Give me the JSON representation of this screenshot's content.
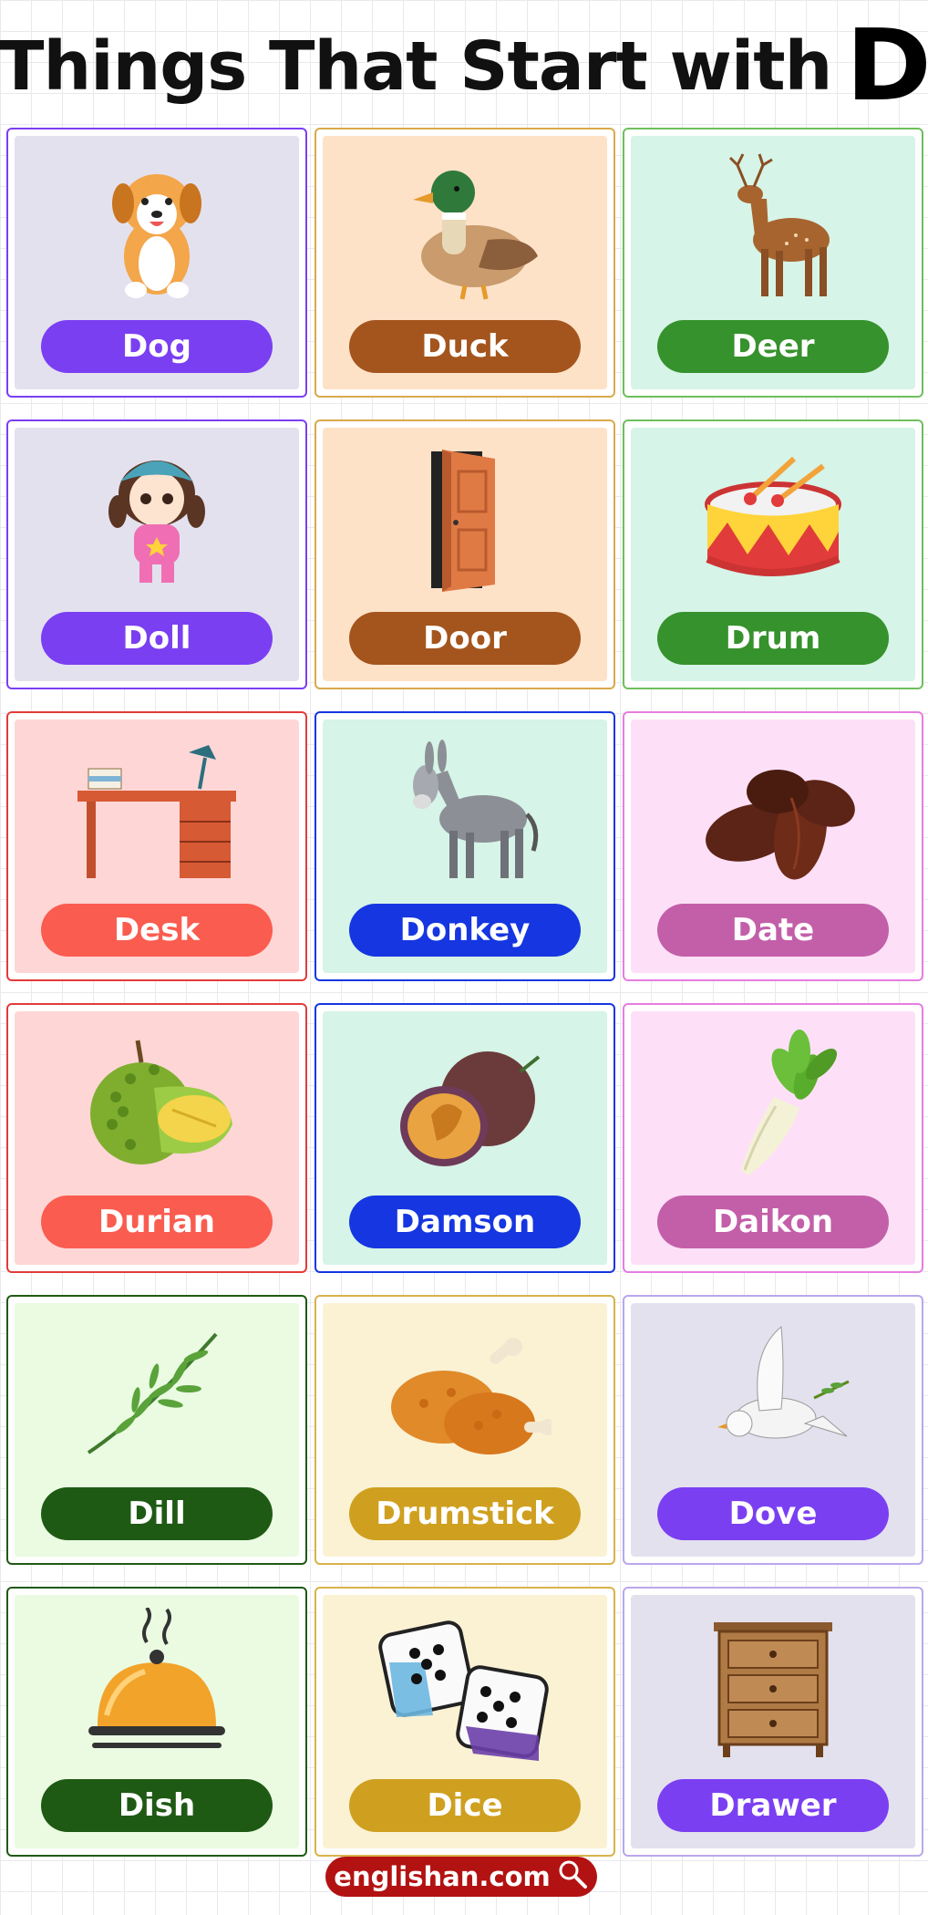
{
  "title": {
    "text": "Things That Start with",
    "letter": "D"
  },
  "footer": {
    "text": "englishan.com",
    "icon": "magnifier-icon"
  },
  "cards": [
    {
      "word": "Dog",
      "icon": "dog",
      "label_color": "#7b3ff2",
      "bg": "#e3e1ee",
      "border": "#7b3ff2"
    },
    {
      "word": "Duck",
      "icon": "duck",
      "label_color": "#a4551d",
      "bg": "#fde2c8",
      "border": "#d9a94a"
    },
    {
      "word": "Deer",
      "icon": "deer",
      "label_color": "#36922c",
      "bg": "#d6f4e7",
      "border": "#6fbf5c"
    },
    {
      "word": "Doll",
      "icon": "doll",
      "label_color": "#7b3ff2",
      "bg": "#e3e1ee",
      "border": "#7b3ff2"
    },
    {
      "word": "Door",
      "icon": "door",
      "label_color": "#a4551d",
      "bg": "#fde2c8",
      "border": "#d9a94a"
    },
    {
      "word": "Drum",
      "icon": "drum",
      "label_color": "#36922c",
      "bg": "#d6f4e7",
      "border": "#6fbf5c"
    },
    {
      "word": "Desk",
      "icon": "desk",
      "label_color": "#fa5c50",
      "bg": "#ffd6d6",
      "border": "#e23b3b"
    },
    {
      "word": "Donkey",
      "icon": "donkey",
      "label_color": "#1536e0",
      "bg": "#d6f4e7",
      "border": "#1536e0"
    },
    {
      "word": "Date",
      "icon": "date",
      "label_color": "#c35fa9",
      "bg": "#fde0f7",
      "border": "#e77de0"
    },
    {
      "word": "Durian",
      "icon": "durian",
      "label_color": "#fa5c50",
      "bg": "#ffd6d6",
      "border": "#e23b3b"
    },
    {
      "word": "Damson",
      "icon": "damson",
      "label_color": "#1536e0",
      "bg": "#d6f4e7",
      "border": "#1536e0"
    },
    {
      "word": "Daikon",
      "icon": "daikon",
      "label_color": "#c35fa9",
      "bg": "#fde0f7",
      "border": "#e77de0"
    },
    {
      "word": "Dill",
      "icon": "dill",
      "label_color": "#1f5a14",
      "bg": "#eafbe2",
      "border": "#1f5a14"
    },
    {
      "word": "Drumstick",
      "icon": "drumstick",
      "label_color": "#cfa020",
      "bg": "#fbf2d4",
      "border": "#d9b24a"
    },
    {
      "word": "Dove",
      "icon": "dove",
      "label_color": "#7b3ff2",
      "bg": "#e3e1ee",
      "border": "#b9a7ee"
    },
    {
      "word": "Dish",
      "icon": "dish",
      "label_color": "#1f5a14",
      "bg": "#eafbe2",
      "border": "#1f5a14"
    },
    {
      "word": "Dice",
      "icon": "dice",
      "label_color": "#cfa020",
      "bg": "#fbf2d4",
      "border": "#d9b24a"
    },
    {
      "word": "Drawer",
      "icon": "drawer",
      "label_color": "#7b3ff2",
      "bg": "#e3e1ee",
      "border": "#b9a7ee"
    }
  ]
}
